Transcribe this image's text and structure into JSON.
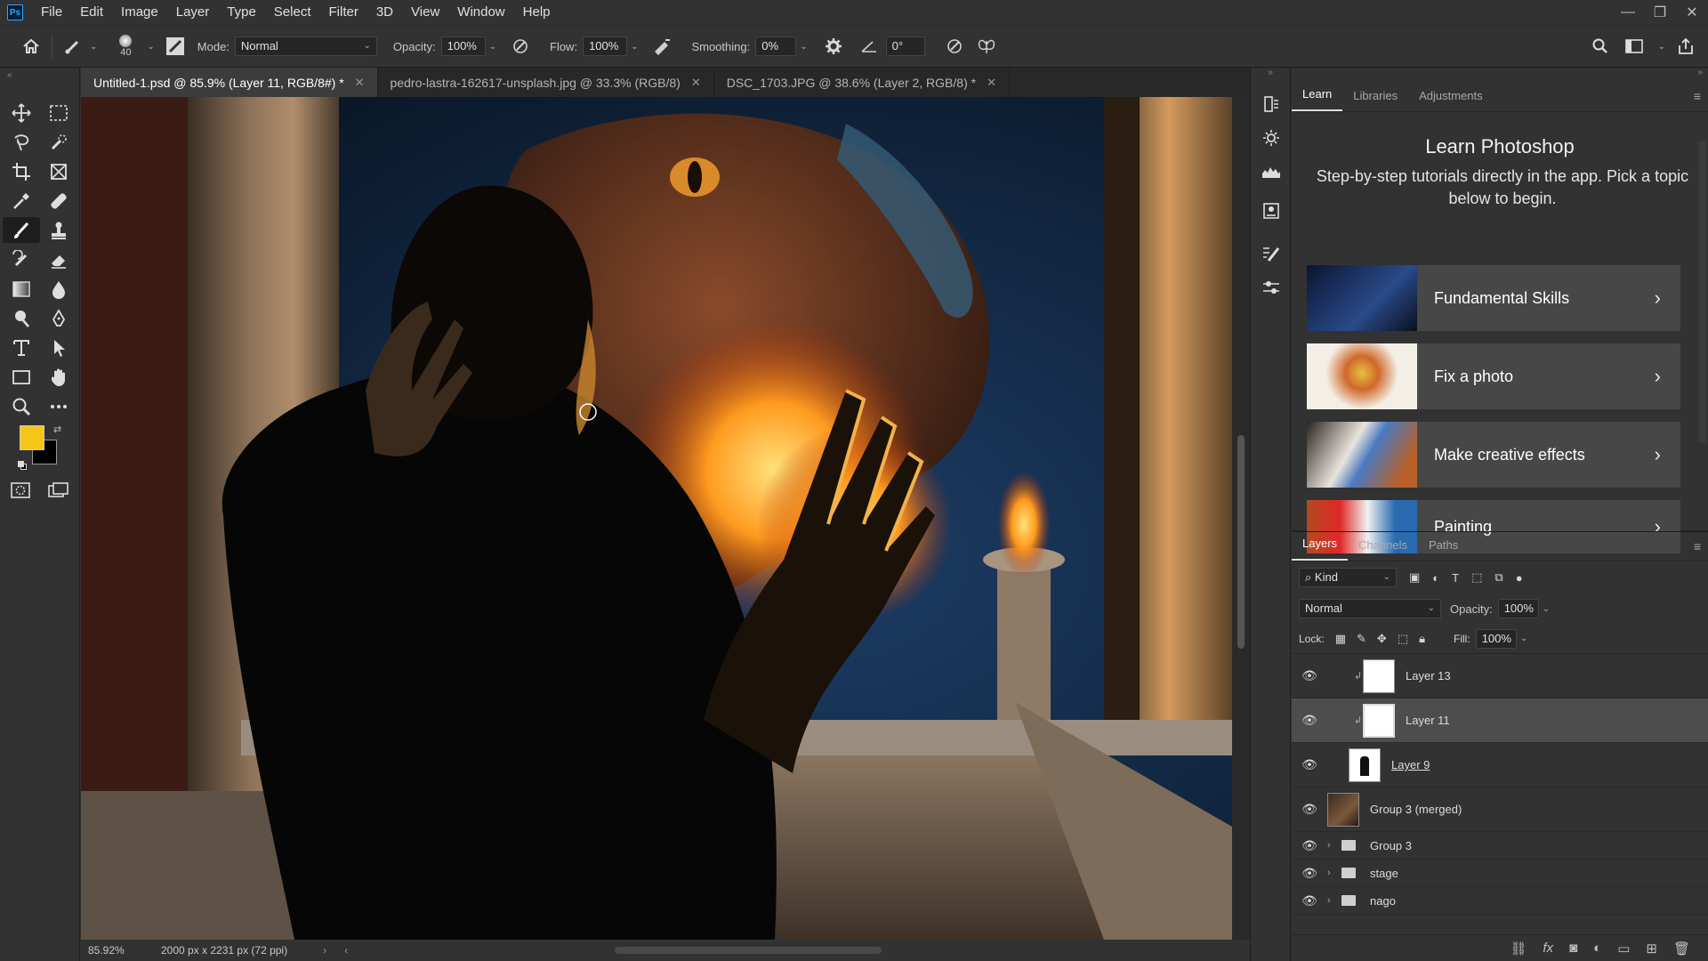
{
  "menu": {
    "app_icon": "Ps",
    "items": [
      "File",
      "Edit",
      "Image",
      "Layer",
      "Type",
      "Select",
      "Filter",
      "3D",
      "View",
      "Window",
      "Help"
    ]
  },
  "options": {
    "brush_size": "40",
    "mode_label": "Mode:",
    "mode_value": "Normal",
    "opacity_label": "Opacity:",
    "opacity_value": "100%",
    "flow_label": "Flow:",
    "flow_value": "100%",
    "smoothing_label": "Smoothing:",
    "smoothing_value": "0%",
    "angle_value": "0°"
  },
  "tabs": [
    {
      "label": "Untitled-1.psd @ 85.9% (Layer 11, RGB/8#) *"
    },
    {
      "label": "pedro-lastra-162617-unsplash.jpg @ 33.3% (RGB/8)"
    },
    {
      "label": "DSC_1703.JPG @ 38.6% (Layer 2, RGB/8) *"
    }
  ],
  "status": {
    "zoom": "85.92%",
    "doc_info": "2000 px x 2231 px (72 ppi)"
  },
  "colors": {
    "foreground": "#f5c518",
    "background": "#000000"
  },
  "learn_panel": {
    "tabs": [
      "Learn",
      "Libraries",
      "Adjustments"
    ],
    "title": "Learn Photoshop",
    "subtitle": "Step-by-step tutorials directly in the app. Pick a topic below to begin.",
    "cards": [
      {
        "label": "Fundamental Skills"
      },
      {
        "label": "Fix a photo"
      },
      {
        "label": "Make creative effects"
      },
      {
        "label": "Painting"
      }
    ]
  },
  "layers_panel": {
    "tabs": [
      "Layers",
      "Channels",
      "Paths"
    ],
    "kind_label": "Kind",
    "blend_mode": "Normal",
    "opacity_label": "Opacity:",
    "opacity_value": "100%",
    "lock_label": "Lock:",
    "fill_label": "Fill:",
    "fill_value": "100%",
    "layers": [
      {
        "name": "Layer 13"
      },
      {
        "name": "Layer 11"
      },
      {
        "name": "Layer 9"
      },
      {
        "name": "Group 3 (merged)"
      },
      {
        "name": "Group 3"
      },
      {
        "name": "stage"
      },
      {
        "name": "nago"
      }
    ]
  }
}
